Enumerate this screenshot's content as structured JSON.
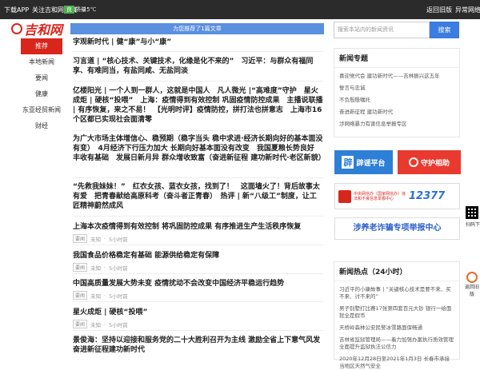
{
  "topbar": {
    "download": "下载APP",
    "follow": "关注吉和网",
    "city": "北京",
    "weather": "16℃～25℃",
    "air_label": "空气质量：",
    "air": "良",
    "back_home": "返回旧版",
    "other": "异常网络"
  },
  "logo": {
    "text": "吉和网"
  },
  "nav": [
    "推荐",
    "本地新闻",
    "要闻",
    "健康",
    "东亚经贸新闻",
    "财经"
  ],
  "notice": "为您推荐了1篇文章",
  "articles": [
    {
      "title": "字观新时代 | 健“康”与小“康”"
    },
    {
      "title": "习言道 | “核心技术、关键技术，化缘是化不来的”　习近平：与群众有福同享、有难同当，有盐同咸、无盐同淡"
    },
    {
      "title": "亿楼阳光 | 一个人到一群人，这就是中国人　凡人微光 |“高难度”守护　星火成炬 | 硬核“投喂”　上海：疫情得到有效控制 巩固疫情防控成果　主播说联播 | 有序恢复，来之不易！　【光明时评】疫情防控，拼打法也拼意志　上海市16个区都已实现社会面清零"
    },
    {
      "title": "为广大市场主体增信心、稳预期（稳字当头 稳中求进·经济长期向好的基本面没有变）　4月经济下行压力加大 长期向好基本面没有改变　我国夏粮长势良好 丰收有基础　发展日新月异 群众增收致富（奋进新征程 建功新时代·老区新貌）"
    },
    {
      "title": "“先救我妹妹！”　红衣女孩、蓝衣女孩，找到了！　这面墙火了！背后故事太有爱　把青春献给高原科考（奋斗者正青春）　热评 | 新“八级工”制度，让工匠精神蔚然成风"
    },
    {
      "title": "上海本次疫情得到有效控制 将巩固防控成果 有序推进生产生活秩序恢复",
      "tag": "要闻",
      "src": "未知",
      "time": "5小时前"
    },
    {
      "title": "我国食品价格稳定有基础 能源供给稳定有保障",
      "tag": "要闻",
      "src": "未知",
      "time": "5小时前"
    },
    {
      "title": "中国高质量发展大势未变 疫情扰动不会改变中国经济平稳运行趋势",
      "tag": "要闻",
      "src": "未知",
      "time": "5小时前"
    },
    {
      "title": "星火成炬 | 硬核“投喂”",
      "tag": "要闻",
      "src": "未知",
      "time": "5小时前"
    },
    {
      "title": "景俊海：坚持以迎接和服务党的二十大胜利召开为主线 激励全省上下意气风发奋进新征程建功新时代"
    }
  ],
  "search": {
    "placeholder": "搜索本站内的新闻资讯",
    "button": "搜索"
  },
  "topics": {
    "title": "新闻专题",
    "items": [
      "喜迎党代会 建功新时代——吉林振兴这五年",
      "誓言与忠诚",
      "不负殷殷嘱托",
      "奋进新征程 建功新时代",
      "涉网络暴力有害信息举报专区"
    ]
  },
  "banners": {
    "piyao": "辟谣平台",
    "shouhu": "守护相助",
    "report_center": "中央网信办（国家网信办）违法和不良信息举报中心",
    "hotline": "12377",
    "fraud": "涉养老诈骗专项举报中心"
  },
  "hot": {
    "title": "新闻热点（24小时）",
    "items": [
      "习近平的小康故事 | “关键核心技术是要不来、买不来、讨不来的”",
      "男子别墅打比赛17张第四套百元大钞 银行一给面就全是假币",
      "天桥岭森林公安民警冰雪路面保畅通",
      "吉林省监狱管理局——着力加强办案执行质效管理 全面提升监狱执法公信力",
      "2020年12月28日至2021年1月3日 长春市承接当地区天然气安全"
    ]
  },
  "side": {
    "qr_label": "扫码下载",
    "home_label": "返回旧版"
  },
  "colors": {
    "brand": "#d9261c",
    "accent": "#3b7de0",
    "topbar": "#2b2b2b"
  }
}
